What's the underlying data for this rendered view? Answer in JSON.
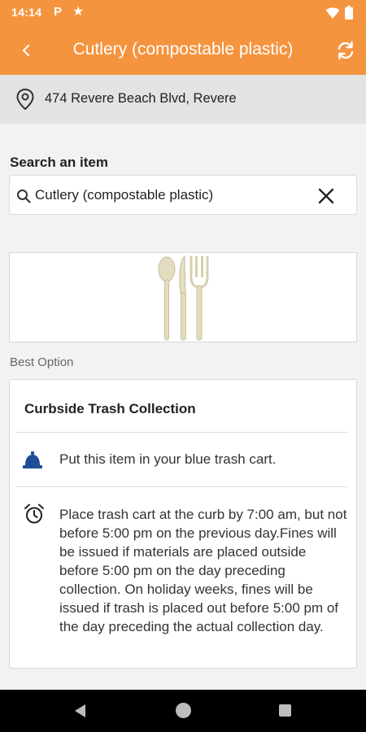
{
  "status_bar": {
    "time": "14:14",
    "p_icon": "P",
    "star_icon": "★",
    "icons": [
      "p-icon",
      "star-icon",
      "wifi-icon",
      "battery-icon"
    ]
  },
  "app_bar": {
    "title": "Cutlery (compostable plastic)",
    "icons": [
      "back-arrow-icon",
      "refresh-icon"
    ],
    "color": "#f5943f"
  },
  "location": {
    "address": "474 Revere Beach Blvd, Revere",
    "icon": "location-pin-icon"
  },
  "search": {
    "label": "Search an item",
    "value": "Cutlery (compostable plastic)",
    "icons": [
      "search-icon",
      "clear-icon"
    ]
  },
  "item_image": {
    "description_icon": "cutlery-image"
  },
  "best_option": {
    "label": "Best Option",
    "card": {
      "title": "Curbside Trash Collection",
      "instructions": [
        {
          "icon": "bell-icon",
          "text": "Put this item in your blue trash cart."
        },
        {
          "icon": "alarm-clock-icon",
          "text": "Place trash cart at the curb by 7:00 am, but not before 5:00 pm on the previous day.Fines will be issued if materials are placed outside before 5:00 pm on the day preceding collection. On holiday weeks, fines will be issued if trash is placed out before 5:00 pm of the day preceding the actual collection day."
        }
      ]
    }
  },
  "nav_bar": {
    "icons": [
      "nav-back-icon",
      "nav-home-icon",
      "nav-recents-icon"
    ]
  },
  "colors": {
    "accent": "#f5943f",
    "bell_blue": "#1f4e96"
  }
}
